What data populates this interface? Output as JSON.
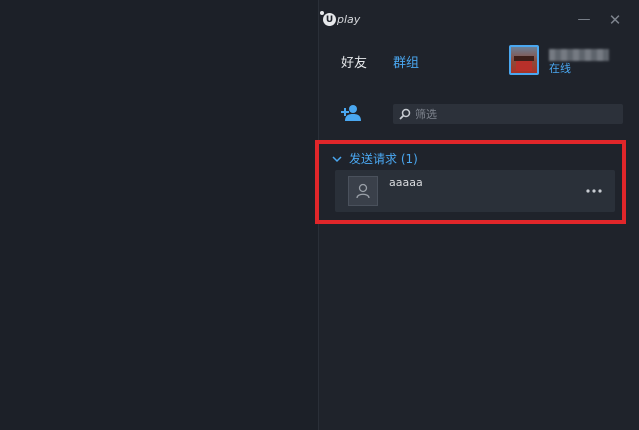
{
  "app": {
    "logo_text": "play"
  },
  "window": {
    "minimize_symbol": "—",
    "close_symbol": "✕"
  },
  "tabs": [
    {
      "label": "好友",
      "active": true
    },
    {
      "label": "群组",
      "active": false
    }
  ],
  "profile": {
    "status": "在线"
  },
  "search": {
    "placeholder": "筛选"
  },
  "requests_section": {
    "title": "发送请求 (1)",
    "items": [
      {
        "name": "aaaaa"
      }
    ]
  },
  "colors": {
    "accent": "#4aa7f0",
    "highlight": "#e0262a",
    "background": "#1c2028",
    "panel": "#1f232b"
  },
  "icons": {
    "logo": "uplay-logo-icon",
    "add_friend": "add-friend-icon",
    "search": "search-icon",
    "chevron": "chevron-down-icon",
    "user": "user-icon",
    "more": "more-icon"
  }
}
